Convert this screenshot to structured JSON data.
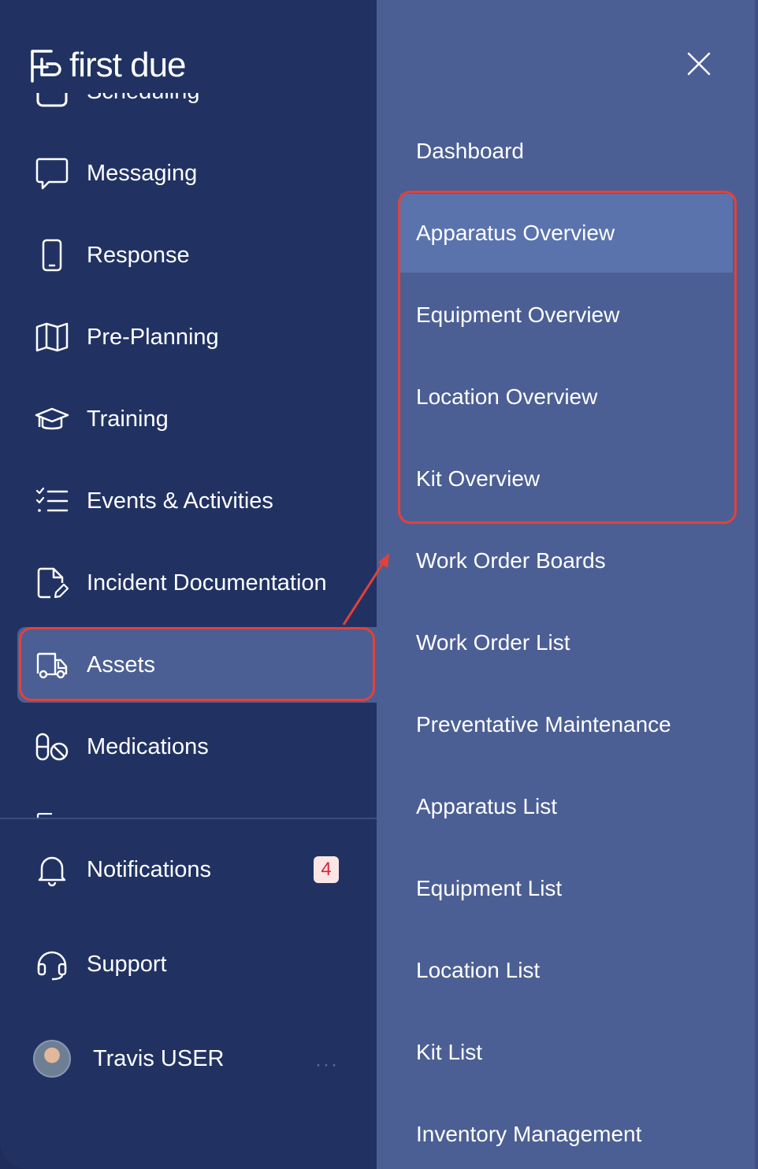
{
  "brand": {
    "name": "first due"
  },
  "nav": {
    "cutoff_label": "Scheduling",
    "items": [
      {
        "label": "Messaging",
        "icon": "chat-bubble-icon"
      },
      {
        "label": "Response",
        "icon": "mobile-phone-icon"
      },
      {
        "label": "Pre-Planning",
        "icon": "map-icon"
      },
      {
        "label": "Training",
        "icon": "graduation-cap-icon"
      },
      {
        "label": "Events & Activities",
        "icon": "checklist-icon"
      },
      {
        "label": "Incident Documentation",
        "icon": "document-edit-icon"
      },
      {
        "label": "Assets",
        "icon": "truck-icon",
        "active": true
      },
      {
        "label": "Medications",
        "icon": "pills-icon"
      }
    ]
  },
  "footer": {
    "notifications_label": "Notifications",
    "notifications_count": "4",
    "support_label": "Support",
    "user_name": "Travis USER",
    "more_label": "···"
  },
  "submenu": {
    "items": [
      {
        "label": "Dashboard"
      },
      {
        "label": "Apparatus Overview",
        "highlighted": true
      },
      {
        "label": "Equipment Overview"
      },
      {
        "label": "Location Overview"
      },
      {
        "label": "Kit Overview"
      },
      {
        "label": "Work Order Boards"
      },
      {
        "label": "Work Order List"
      },
      {
        "label": "Preventative Maintenance"
      },
      {
        "label": "Apparatus List"
      },
      {
        "label": "Equipment List"
      },
      {
        "label": "Location List"
      },
      {
        "label": "Kit List"
      },
      {
        "label": "Inventory Management"
      }
    ]
  },
  "colors": {
    "sidebar_bg": "#213262",
    "submenu_bg": "#4b5f94",
    "active_bg": "#4b5f94",
    "highlight_bg": "#5a73ad",
    "annotation_red": "#e5403a",
    "badge_bg": "#fbe5e5",
    "badge_text": "#d1293b"
  }
}
